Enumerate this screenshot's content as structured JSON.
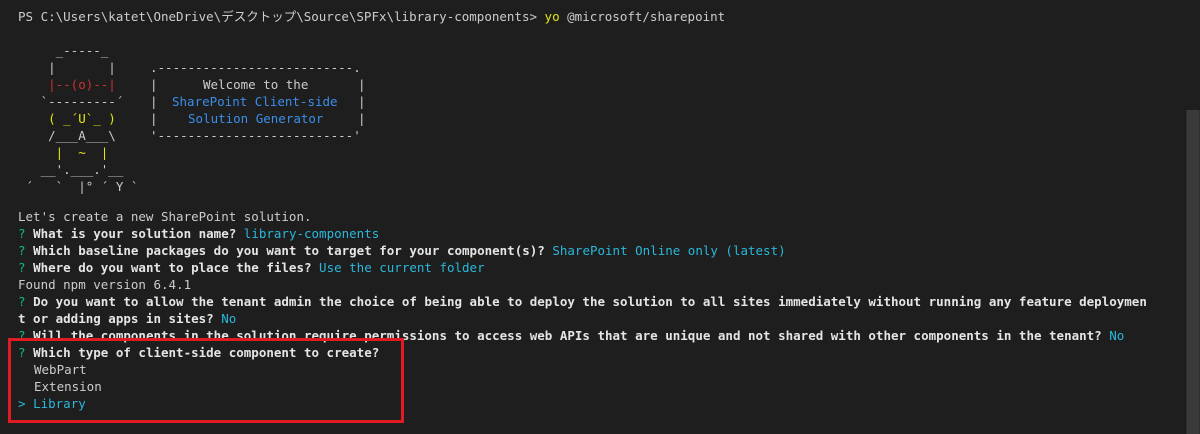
{
  "prompt": {
    "prefix": "PS C:\\Users\\katet\\OneDrive\\デスクトップ\\Source\\SPFx\\library-components> ",
    "command": "yo",
    "args": "@microsoft/sharepoint"
  },
  "banner": {
    "art_lines": [
      "     _-----_",
      "    |       |",
      "    |--(o)--|",
      "   `---------´",
      "    ( _´U`_ )",
      "    /___A___\\",
      "     |  ~  |",
      "   __'.___.'__",
      " ´   `  |° ´ Y `"
    ],
    "box_top": ".--------------------------.",
    "box_line1": "Welcome to the",
    "box_line2": "SharePoint Client-side",
    "box_line3": "Solution Generator",
    "box_bottom": "'--------------------------'"
  },
  "lines": {
    "intro": "Let's create a new SharePoint solution.",
    "q1": "What is your solution name?",
    "a1": "library-components",
    "q2": "Which baseline packages do you want to target for your component(s)?",
    "a2": "SharePoint Online only (latest)",
    "q3": "Where do you want to place the files?",
    "a3": "Use the current folder",
    "npm": "Found npm version 6.4.1",
    "q4a": "Do you want to allow the tenant admin the choice of being able to deploy the solution to all sites immediately without running any feature deploymen",
    "q4b": "t or adding apps in sites?",
    "a4": "No",
    "q5": "Will the components in the solution require permissions to access web APIs that are unique and not shared with other components in the tenant?",
    "a5": "No",
    "q6": "Which type of client-side component to create?",
    "qmark": "?",
    "pointer": ">"
  },
  "options": [
    "WebPart",
    "Extension",
    "Library"
  ],
  "colors": {
    "background": "#1e1e1e",
    "question_mark": "#0dbc79",
    "answer": "#29b8db",
    "highlight_border": "#e01b24"
  }
}
